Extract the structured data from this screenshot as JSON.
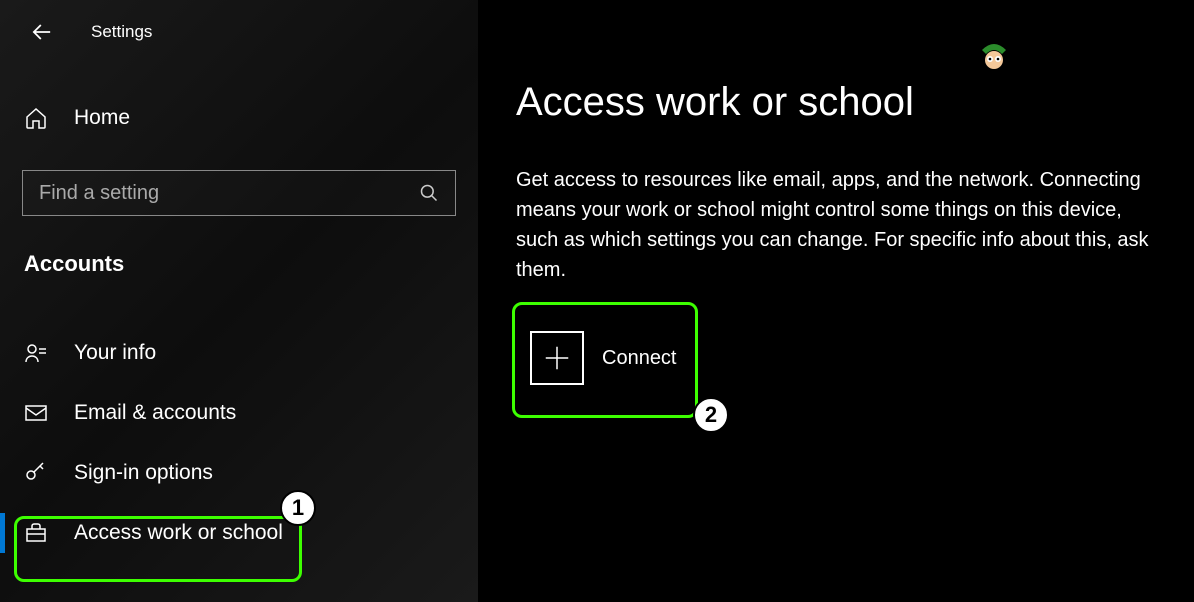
{
  "header": {
    "title": "Settings"
  },
  "sidebar": {
    "home_label": "Home",
    "search_placeholder": "Find a setting",
    "section_title": "Accounts",
    "items": [
      {
        "label": "Your info",
        "icon": "user-info-icon"
      },
      {
        "label": "Email & accounts",
        "icon": "email-icon"
      },
      {
        "label": "Sign-in options",
        "icon": "key-icon"
      },
      {
        "label": "Access work or school",
        "icon": "briefcase-icon"
      }
    ]
  },
  "main": {
    "title": "Access work or school",
    "description": "Get access to resources like email, apps, and the network. Connecting means your work or school might control some things on this device, such as which settings you can change. For specific info about this, ask them.",
    "connect_label": "Connect"
  },
  "annotations": {
    "badge_1": "1",
    "badge_2": "2"
  }
}
